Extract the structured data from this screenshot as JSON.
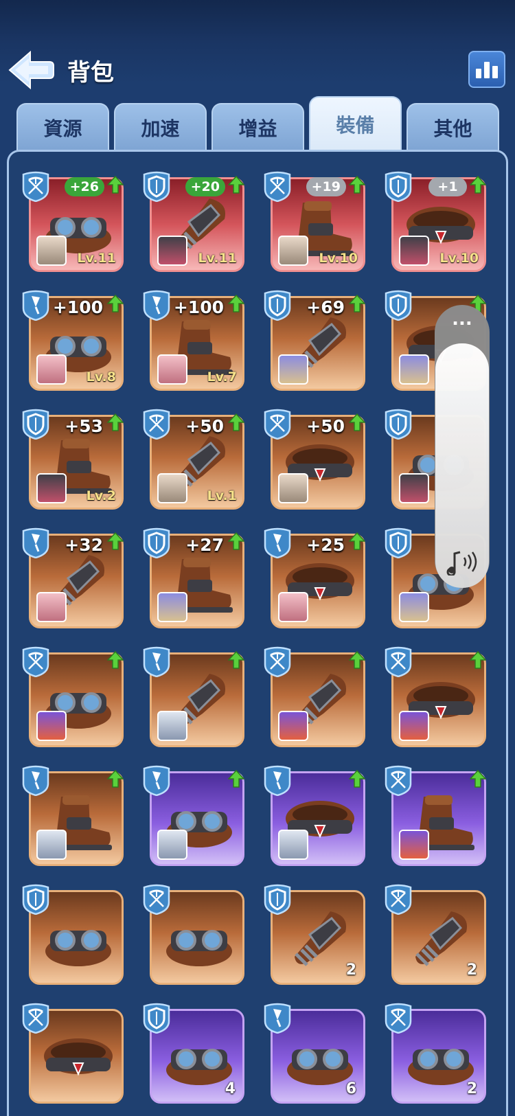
{
  "header": {
    "title": "背包",
    "back_icon": "back-arrow-icon",
    "stats_icon": "bar-chart-icon"
  },
  "tabs": [
    {
      "label": "資源",
      "active": false
    },
    {
      "label": "加速",
      "active": false
    },
    {
      "label": "增益",
      "active": false
    },
    {
      "label": "裝備",
      "active": true
    },
    {
      "label": "其他",
      "active": false
    }
  ],
  "colors": {
    "background": "#1d3d6f",
    "accent_green": "#3aa63a",
    "rarity_red": "#d4555b",
    "rarity_orange": "#b96b3a",
    "rarity_purple": "#8a5ee0"
  },
  "overlay": {
    "menu_label": "...",
    "icon": "sound-icon"
  },
  "items": [
    {
      "type": "crossbow",
      "equip": "goggles",
      "rarity": "red",
      "bonus": "+26",
      "bonus_style": "green",
      "upgrade": true,
      "avatar": "bearded-dwarf",
      "level": "Lv.11",
      "count": ""
    },
    {
      "type": "shield",
      "equip": "gauntlet",
      "rarity": "red",
      "bonus": "+20",
      "bonus_style": "green",
      "upgrade": true,
      "avatar": "helmet-knight",
      "level": "Lv.11",
      "count": ""
    },
    {
      "type": "crossbow",
      "equip": "boot",
      "rarity": "red",
      "bonus": "+19",
      "bonus_style": "grey",
      "upgrade": true,
      "avatar": "bearded-dwarf",
      "level": "Lv.10",
      "count": ""
    },
    {
      "type": "shield",
      "equip": "belt",
      "rarity": "red",
      "bonus": "+1",
      "bonus_style": "grey",
      "upgrade": true,
      "avatar": "helmet-knight",
      "level": "Lv.10",
      "count": ""
    },
    {
      "type": "dagger",
      "equip": "goggles",
      "rarity": "orange",
      "bonus": "+100",
      "bonus_style": "plain",
      "upgrade": true,
      "avatar": "pink-hair-girl",
      "level": "Lv.8",
      "count": ""
    },
    {
      "type": "dagger",
      "equip": "boot",
      "rarity": "orange",
      "bonus": "+100",
      "bonus_style": "plain",
      "upgrade": true,
      "avatar": "pink-hair-girl",
      "level": "Lv.7",
      "count": ""
    },
    {
      "type": "shield",
      "equip": "gauntlet",
      "rarity": "orange",
      "bonus": "+69",
      "bonus_style": "plain",
      "upgrade": true,
      "avatar": "old-wizard",
      "level": "",
      "count": ""
    },
    {
      "type": "shield",
      "equip": "belt",
      "rarity": "orange",
      "bonus": "",
      "bonus_style": "plain",
      "upgrade": true,
      "avatar": "old-wizard",
      "level": "",
      "count": ""
    },
    {
      "type": "shield",
      "equip": "boot",
      "rarity": "orange",
      "bonus": "+53",
      "bonus_style": "plain",
      "upgrade": true,
      "avatar": "helmet-knight",
      "level": "Lv.2",
      "count": ""
    },
    {
      "type": "crossbow",
      "equip": "gauntlet",
      "rarity": "orange",
      "bonus": "+50",
      "bonus_style": "plain",
      "upgrade": true,
      "avatar": "bearded-dwarf",
      "level": "Lv.1",
      "count": ""
    },
    {
      "type": "crossbow",
      "equip": "belt",
      "rarity": "orange",
      "bonus": "+50",
      "bonus_style": "plain",
      "upgrade": true,
      "avatar": "bearded-dwarf",
      "level": "",
      "count": ""
    },
    {
      "type": "shield",
      "equip": "goggles",
      "rarity": "orange",
      "bonus": "",
      "bonus_style": "plain",
      "upgrade": false,
      "avatar": "helmet-knight",
      "level": "",
      "count": ""
    },
    {
      "type": "dagger",
      "equip": "gauntlet",
      "rarity": "orange",
      "bonus": "+32",
      "bonus_style": "plain",
      "upgrade": true,
      "avatar": "pink-hair-girl",
      "level": "",
      "count": ""
    },
    {
      "type": "shield",
      "equip": "boot",
      "rarity": "orange",
      "bonus": "+27",
      "bonus_style": "plain",
      "upgrade": true,
      "avatar": "old-wizard",
      "level": "",
      "count": ""
    },
    {
      "type": "dagger",
      "equip": "belt",
      "rarity": "orange",
      "bonus": "+25",
      "bonus_style": "plain",
      "upgrade": true,
      "avatar": "pink-hair-girl",
      "level": "",
      "count": ""
    },
    {
      "type": "shield",
      "equip": "goggles",
      "rarity": "orange",
      "bonus": "",
      "bonus_style": "plain",
      "upgrade": false,
      "avatar": "old-wizard",
      "level": "",
      "count": ""
    },
    {
      "type": "crossbow",
      "equip": "goggles",
      "rarity": "orange",
      "bonus": "",
      "bonus_style": "plain",
      "upgrade": true,
      "avatar": "red-hair-girl",
      "level": "",
      "count": ""
    },
    {
      "type": "dagger",
      "equip": "gauntlet",
      "rarity": "orange",
      "bonus": "",
      "bonus_style": "plain",
      "upgrade": true,
      "avatar": "white-hair-girl",
      "level": "",
      "count": ""
    },
    {
      "type": "crossbow",
      "equip": "gauntlet",
      "rarity": "orange",
      "bonus": "",
      "bonus_style": "plain",
      "upgrade": true,
      "avatar": "red-hair-girl",
      "level": "",
      "count": ""
    },
    {
      "type": "crossbow",
      "equip": "belt",
      "rarity": "orange",
      "bonus": "",
      "bonus_style": "plain",
      "upgrade": true,
      "avatar": "red-hair-girl",
      "level": "",
      "count": ""
    },
    {
      "type": "dagger",
      "equip": "boot",
      "rarity": "orange",
      "bonus": "",
      "bonus_style": "plain",
      "upgrade": true,
      "avatar": "white-hair-girl",
      "level": "",
      "count": ""
    },
    {
      "type": "dagger",
      "equip": "goggles",
      "rarity": "purple",
      "bonus": "",
      "bonus_style": "plain",
      "upgrade": true,
      "avatar": "white-hair-girl",
      "level": "",
      "count": ""
    },
    {
      "type": "dagger",
      "equip": "belt",
      "rarity": "purple",
      "bonus": "",
      "bonus_style": "plain",
      "upgrade": true,
      "avatar": "white-hair-girl",
      "level": "",
      "count": ""
    },
    {
      "type": "crossbow",
      "equip": "boot",
      "rarity": "purple",
      "bonus": "",
      "bonus_style": "plain",
      "upgrade": true,
      "avatar": "red-hair-girl",
      "level": "",
      "count": ""
    },
    {
      "type": "shield",
      "equip": "goggles",
      "rarity": "orange",
      "bonus": "",
      "bonus_style": "plain",
      "upgrade": false,
      "avatar": "",
      "level": "",
      "count": ""
    },
    {
      "type": "crossbow",
      "equip": "goggles",
      "rarity": "orange",
      "bonus": "",
      "bonus_style": "plain",
      "upgrade": false,
      "avatar": "",
      "level": "",
      "count": ""
    },
    {
      "type": "shield",
      "equip": "gauntlet",
      "rarity": "orange",
      "bonus": "",
      "bonus_style": "plain",
      "upgrade": false,
      "avatar": "",
      "level": "",
      "count": "2"
    },
    {
      "type": "crossbow",
      "equip": "gauntlet",
      "rarity": "orange",
      "bonus": "",
      "bonus_style": "plain",
      "upgrade": false,
      "avatar": "",
      "level": "",
      "count": "2"
    },
    {
      "type": "crossbow",
      "equip": "belt",
      "rarity": "orange",
      "bonus": "",
      "bonus_style": "plain",
      "upgrade": false,
      "avatar": "",
      "level": "",
      "count": ""
    },
    {
      "type": "shield",
      "equip": "goggles",
      "rarity": "purple",
      "bonus": "",
      "bonus_style": "plain",
      "upgrade": false,
      "avatar": "",
      "level": "",
      "count": "4"
    },
    {
      "type": "dagger",
      "equip": "goggles",
      "rarity": "purple",
      "bonus": "",
      "bonus_style": "plain",
      "upgrade": false,
      "avatar": "",
      "level": "",
      "count": "6"
    },
    {
      "type": "crossbow",
      "equip": "goggles",
      "rarity": "purple",
      "bonus": "",
      "bonus_style": "plain",
      "upgrade": false,
      "avatar": "",
      "level": "",
      "count": "2"
    }
  ]
}
